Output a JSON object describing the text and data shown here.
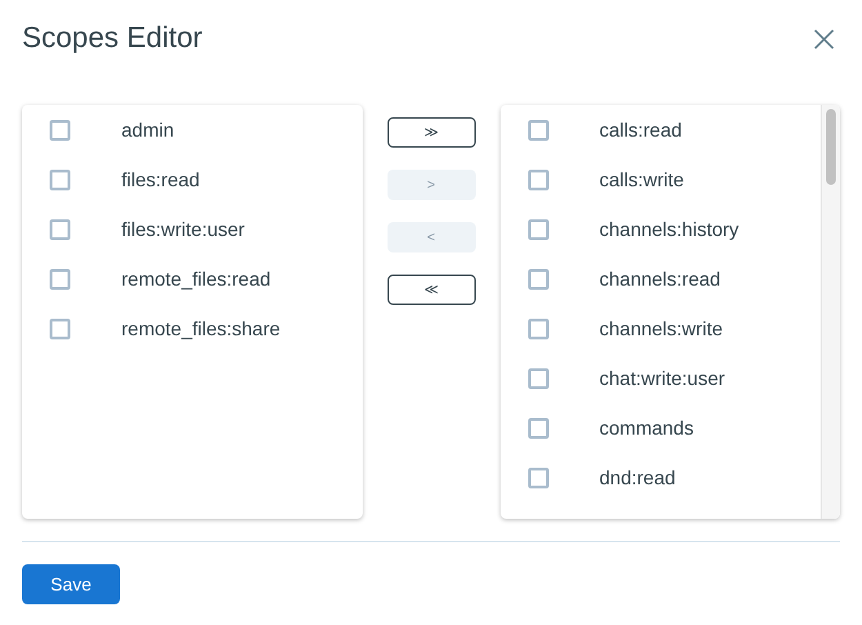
{
  "window": {
    "title": "Scopes Editor"
  },
  "available": [
    {
      "label": "admin",
      "checked": false
    },
    {
      "label": "files:read",
      "checked": false
    },
    {
      "label": "files:write:user",
      "checked": false
    },
    {
      "label": "remote_files:read",
      "checked": false
    },
    {
      "label": "remote_files:share",
      "checked": false
    }
  ],
  "transfer_buttons": [
    {
      "label": "≫",
      "disabled": false
    },
    {
      "label": ">",
      "disabled": true
    },
    {
      "label": "<",
      "disabled": true
    },
    {
      "label": "≪",
      "disabled": false
    }
  ],
  "selected_scopes": [
    {
      "label": "calls:read",
      "checked": false
    },
    {
      "label": "calls:write",
      "checked": false
    },
    {
      "label": "channels:history",
      "checked": false
    },
    {
      "label": "channels:read",
      "checked": false
    },
    {
      "label": "channels:write",
      "checked": false
    },
    {
      "label": "chat:write:user",
      "checked": false
    },
    {
      "label": "commands",
      "checked": false
    },
    {
      "label": "dnd:read",
      "checked": false
    }
  ],
  "save_button": "Save"
}
